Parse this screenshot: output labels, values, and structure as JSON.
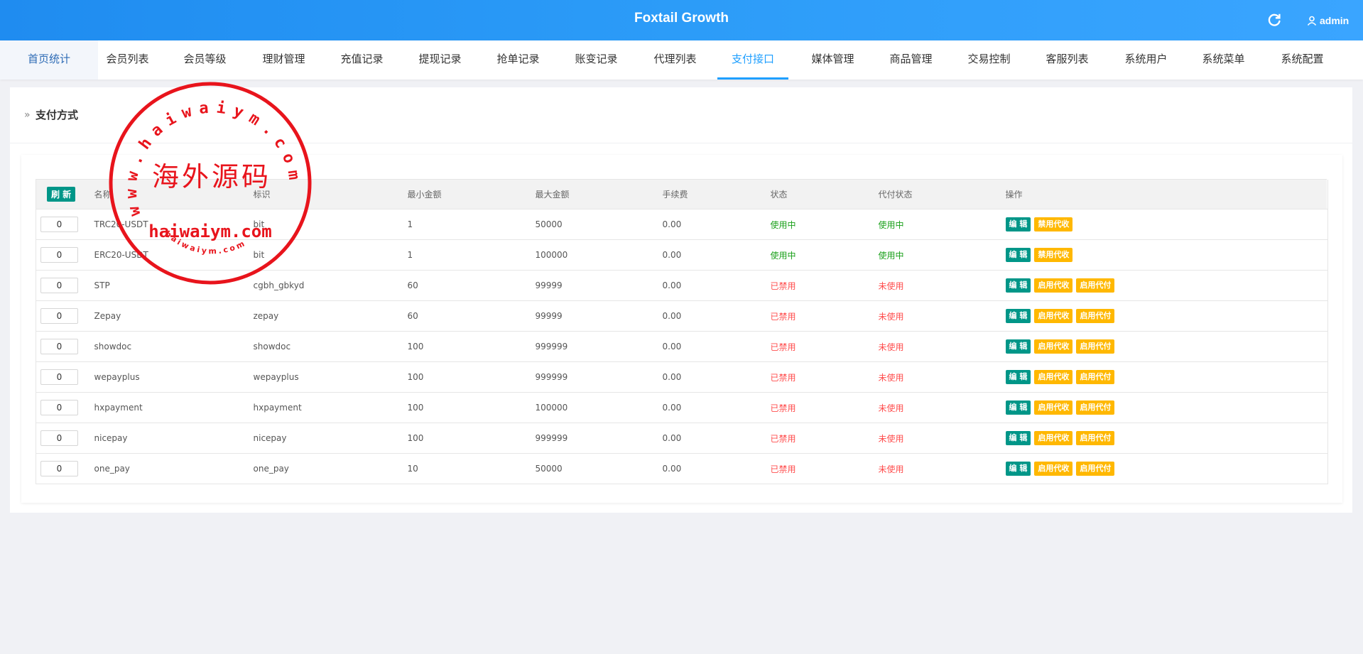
{
  "header": {
    "title": "Foxtail Growth",
    "user": "admin",
    "refresh_icon": "refresh-icon",
    "user_icon": "user-icon"
  },
  "nav": {
    "items": [
      {
        "label": "首页统计",
        "x": 0,
        "w": 75
      },
      {
        "label": "会员列表"
      },
      {
        "label": "会员等级"
      },
      {
        "label": "理财管理"
      },
      {
        "label": "充值记录"
      },
      {
        "label": "提现记录"
      },
      {
        "label": "抢单记录"
      },
      {
        "label": "账变记录"
      },
      {
        "label": "代理列表"
      },
      {
        "label": "支付接口"
      },
      {
        "label": "媒体管理"
      },
      {
        "label": "商品管理"
      },
      {
        "label": "交易控制"
      },
      {
        "label": "客服列表"
      },
      {
        "label": "系统用户"
      },
      {
        "label": "系统菜单"
      },
      {
        "label": "系统配置"
      }
    ],
    "active_index": 9
  },
  "panel": {
    "title": "支付方式",
    "chevron": "»"
  },
  "table": {
    "refresh_label": "刷 新",
    "headers": [
      "名称",
      "标识",
      "最小金额",
      "最大金额",
      "手续费",
      "状态",
      "代付状态",
      "操作"
    ],
    "buttons": {
      "edit": "编 辑",
      "disable_collect": "禁用代收",
      "enable_collect": "启用代收",
      "enable_pay": "启用代付"
    },
    "rows": [
      {
        "sort": "0",
        "name": "TRC20-USDT",
        "code": "bit",
        "min": "1",
        "max": "50000",
        "fee": "0.00",
        "status": "使用中",
        "pay_status": "使用中",
        "enabled": true
      },
      {
        "sort": "0",
        "name": "ERC20-USDT",
        "code": "bit",
        "min": "1",
        "max": "100000",
        "fee": "0.00",
        "status": "使用中",
        "pay_status": "使用中",
        "enabled": true
      },
      {
        "sort": "0",
        "name": "STP",
        "code": "cgbh_gbkyd",
        "min": "60",
        "max": "99999",
        "fee": "0.00",
        "status": "已禁用",
        "pay_status": "未使用",
        "enabled": false
      },
      {
        "sort": "0",
        "name": "Zepay",
        "code": "zepay",
        "min": "60",
        "max": "99999",
        "fee": "0.00",
        "status": "已禁用",
        "pay_status": "未使用",
        "enabled": false
      },
      {
        "sort": "0",
        "name": "showdoc",
        "code": "showdoc",
        "min": "100",
        "max": "999999",
        "fee": "0.00",
        "status": "已禁用",
        "pay_status": "未使用",
        "enabled": false
      },
      {
        "sort": "0",
        "name": "wepayplus",
        "code": "wepayplus",
        "min": "100",
        "max": "999999",
        "fee": "0.00",
        "status": "已禁用",
        "pay_status": "未使用",
        "enabled": false
      },
      {
        "sort": "0",
        "name": "hxpayment",
        "code": "hxpayment",
        "min": "100",
        "max": "100000",
        "fee": "0.00",
        "status": "已禁用",
        "pay_status": "未使用",
        "enabled": false
      },
      {
        "sort": "0",
        "name": "nicepay",
        "code": "nicepay",
        "min": "100",
        "max": "999999",
        "fee": "0.00",
        "status": "已禁用",
        "pay_status": "未使用",
        "enabled": false
      },
      {
        "sort": "0",
        "name": "one_pay",
        "code": "one_pay",
        "min": "10",
        "max": "50000",
        "fee": "0.00",
        "status": "已禁用",
        "pay_status": "未使用",
        "enabled": false
      }
    ]
  },
  "watermark": {
    "ring_text": "www.haiwaiym.com",
    "center_text": "海外源码",
    "bottom_text": "haiwaiym.com",
    "small_text": "haiwaiym.com",
    "color": "#e8141c"
  },
  "colors": {
    "accent": "#1e9fff",
    "teal": "#009688",
    "amber": "#ffb800",
    "green": "#1aa01a",
    "red": "#ff4d4d"
  }
}
